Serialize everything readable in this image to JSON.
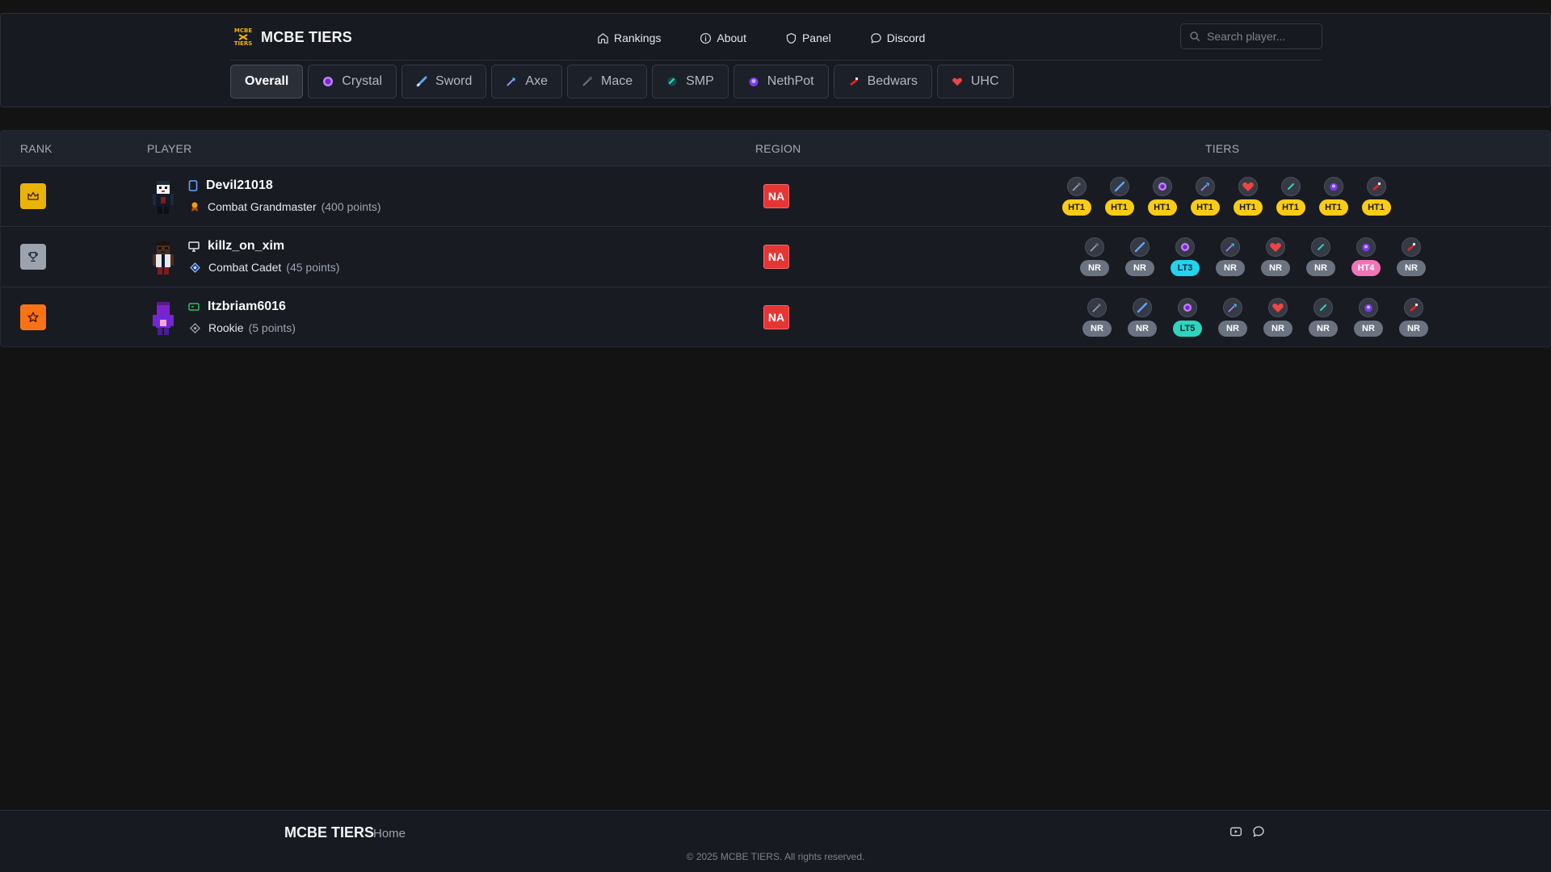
{
  "header": {
    "brand": "MCBE TIERS",
    "logo_text": [
      "MCBE",
      "TIERS"
    ],
    "nav": [
      {
        "label": "Rankings",
        "icon": "home-icon"
      },
      {
        "label": "About",
        "icon": "info-icon"
      },
      {
        "label": "Panel",
        "icon": "shield-icon"
      },
      {
        "label": "Discord",
        "icon": "chat-icon"
      }
    ],
    "search_placeholder": "Search player..."
  },
  "tabs": [
    {
      "label": "Overall",
      "active": true
    },
    {
      "label": "Crystal",
      "icon": "crystal-icon"
    },
    {
      "label": "Sword",
      "icon": "sword-icon"
    },
    {
      "label": "Axe",
      "icon": "axe-icon"
    },
    {
      "label": "Mace",
      "icon": "mace-icon"
    },
    {
      "label": "SMP",
      "icon": "smp-icon"
    },
    {
      "label": "NethPot",
      "icon": "nethpot-icon"
    },
    {
      "label": "Bedwars",
      "icon": "bedwars-icon"
    },
    {
      "label": "UHC",
      "icon": "heart-icon"
    }
  ],
  "table": {
    "columns": [
      "RANK",
      "PLAYER",
      "REGION",
      "TIERS"
    ],
    "rows": [
      {
        "rank_icon": "crown-icon",
        "rank_color": "#eab308",
        "device": "mobile-icon",
        "name": "Devil21018",
        "title": "Combat Grandmaster",
        "points": "(400 points)",
        "title_icon": "medal-icon",
        "region": "NA",
        "tiers": [
          "HT1",
          "HT1",
          "HT1",
          "HT1",
          "HT1",
          "HT1",
          "HT1",
          "HT1"
        ]
      },
      {
        "rank_icon": "trophy-icon",
        "rank_color": "#9ca3af",
        "device": "monitor-icon",
        "name": "killz_on_xim",
        "title": "Combat Cadet",
        "points": "(45 points)",
        "title_icon": "diamond-badge-icon",
        "region": "NA",
        "tiers": [
          "NR",
          "NR",
          "LT3",
          "NR",
          "NR",
          "NR",
          "HT4",
          "NR"
        ]
      },
      {
        "rank_icon": "star-icon",
        "rank_color": "#f97316",
        "device": "gamepad-icon",
        "name": "Itzbriam6016",
        "title": "Rookie",
        "points": "(5 points)",
        "title_icon": "rookie-badge-icon",
        "region": "NA",
        "tiers": [
          "NR",
          "NR",
          "LT5",
          "NR",
          "NR",
          "NR",
          "NR",
          "NR"
        ]
      }
    ],
    "tier_icon_order": [
      "mace-icon",
      "sword-icon",
      "crystal-icon",
      "axe-icon",
      "heart-icon",
      "smp-icon",
      "nethpot-icon",
      "bedwars-icon"
    ]
  },
  "footer": {
    "brand": "MCBE TIERS",
    "home": "Home",
    "copyright": "© 2025 MCBE TIERS. All rights reserved.",
    "icons": [
      "youtube-icon",
      "chat-icon"
    ]
  }
}
